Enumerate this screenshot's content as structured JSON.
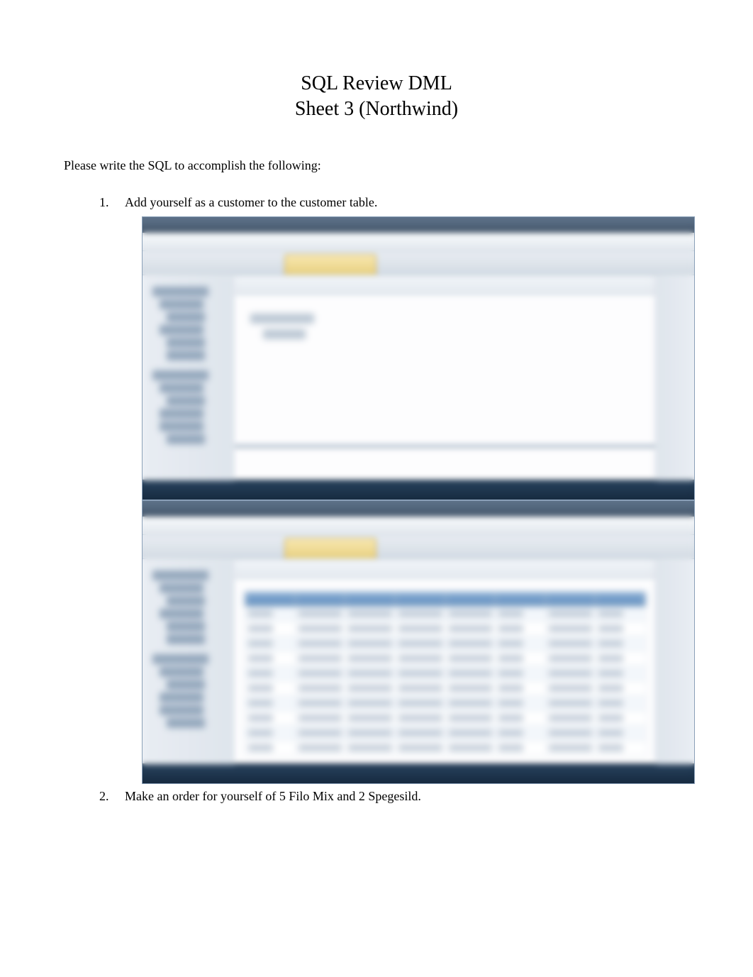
{
  "title": {
    "line1": "SQL Review DML",
    "line2": "Sheet 3 (Northwind)"
  },
  "instruction": "Please write the SQL to accomplish the following:",
  "questions": [
    {
      "num": "1.",
      "text": "Add yourself as a customer to the customer table."
    },
    {
      "num": "2.",
      "text": "Make an order for yourself of 5 Filo Mix and 2 Spegesild."
    }
  ]
}
